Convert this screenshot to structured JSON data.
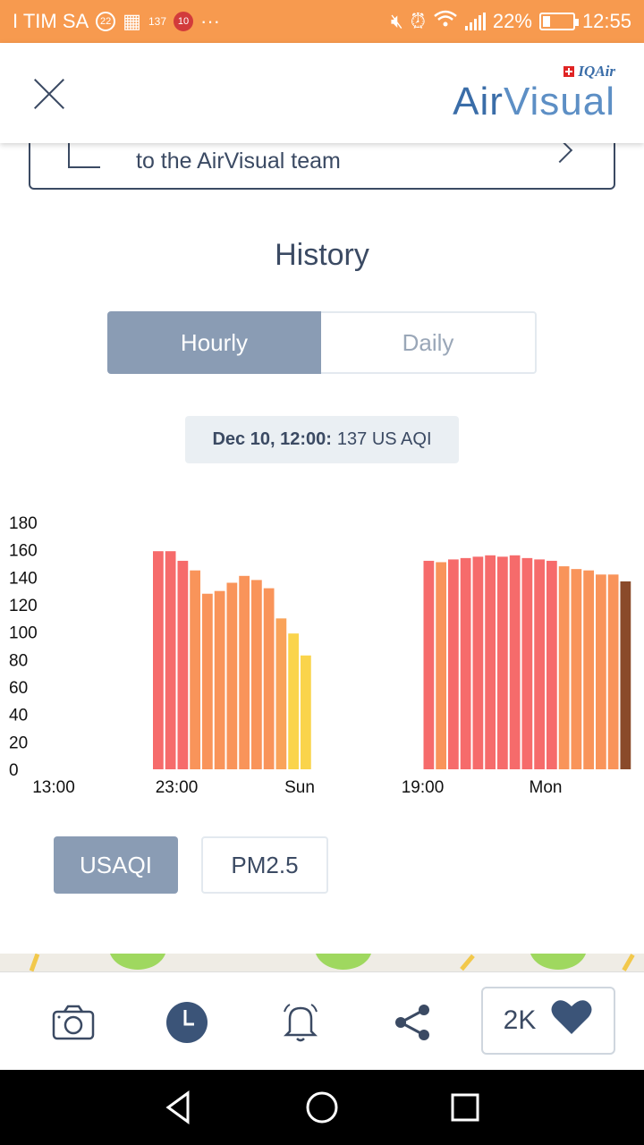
{
  "status_bar": {
    "carrier": "I TIM SA",
    "notif_22": "22",
    "notif_137": "137",
    "notif_10": "10",
    "more": "···",
    "battery": "22%",
    "time": "12:55"
  },
  "header": {
    "brand_top": "IQAir",
    "brand_air": "Air",
    "brand_visual": "Visual"
  },
  "feedback": {
    "text": "to the AirVisual team"
  },
  "history": {
    "title": "History",
    "tab_hourly": "Hourly",
    "tab_daily": "Daily",
    "readout_label": "Dec 10, 12:00:",
    "readout_value": "137 US AQI"
  },
  "chart_data": {
    "type": "bar",
    "ylim": [
      0,
      180
    ],
    "y_ticks": [
      "180",
      "160",
      "140",
      "120",
      "100",
      "80",
      "60",
      "40",
      "20",
      "0"
    ],
    "x_tick_labels": [
      "13:00",
      "23:00",
      "Sun",
      "19:00",
      "Mon"
    ],
    "x_tick_hours": [
      0,
      10,
      20,
      30,
      40
    ],
    "x_range_hours": [
      0,
      48
    ],
    "series": [
      {
        "start_hour": 8.5,
        "values": [
          159,
          159,
          152,
          145,
          128,
          130,
          136,
          141,
          138,
          132,
          110,
          99,
          83
        ],
        "colors": [
          "#f66b6b",
          "#f66b6b",
          "#f66b6b",
          "#f9945a",
          "#f9945a",
          "#f9945a",
          "#f9945a",
          "#f9945a",
          "#f9945a",
          "#f9945a",
          "#f9a35a",
          "#fad44b",
          "#fad44b"
        ]
      },
      {
        "start_hour": 30.5,
        "values": [
          152,
          151,
          153,
          154,
          155,
          156,
          155,
          156,
          154,
          153,
          152,
          148,
          146,
          145,
          142,
          142,
          137
        ],
        "colors": [
          "#f66b6b",
          "#f9945a",
          "#f66b6b",
          "#f66b6b",
          "#f66b6b",
          "#f66b6b",
          "#f66b6b",
          "#f66b6b",
          "#f66b6b",
          "#f66b6b",
          "#f66b6b",
          "#f9945a",
          "#f9945a",
          "#f9945a",
          "#f9945a",
          "#f9945a",
          "#8a4a2a"
        ]
      }
    ]
  },
  "metrics": {
    "usaqi": "USAQI",
    "pm25": "PM2.5"
  },
  "bottom_bar": {
    "likes": "2K"
  }
}
